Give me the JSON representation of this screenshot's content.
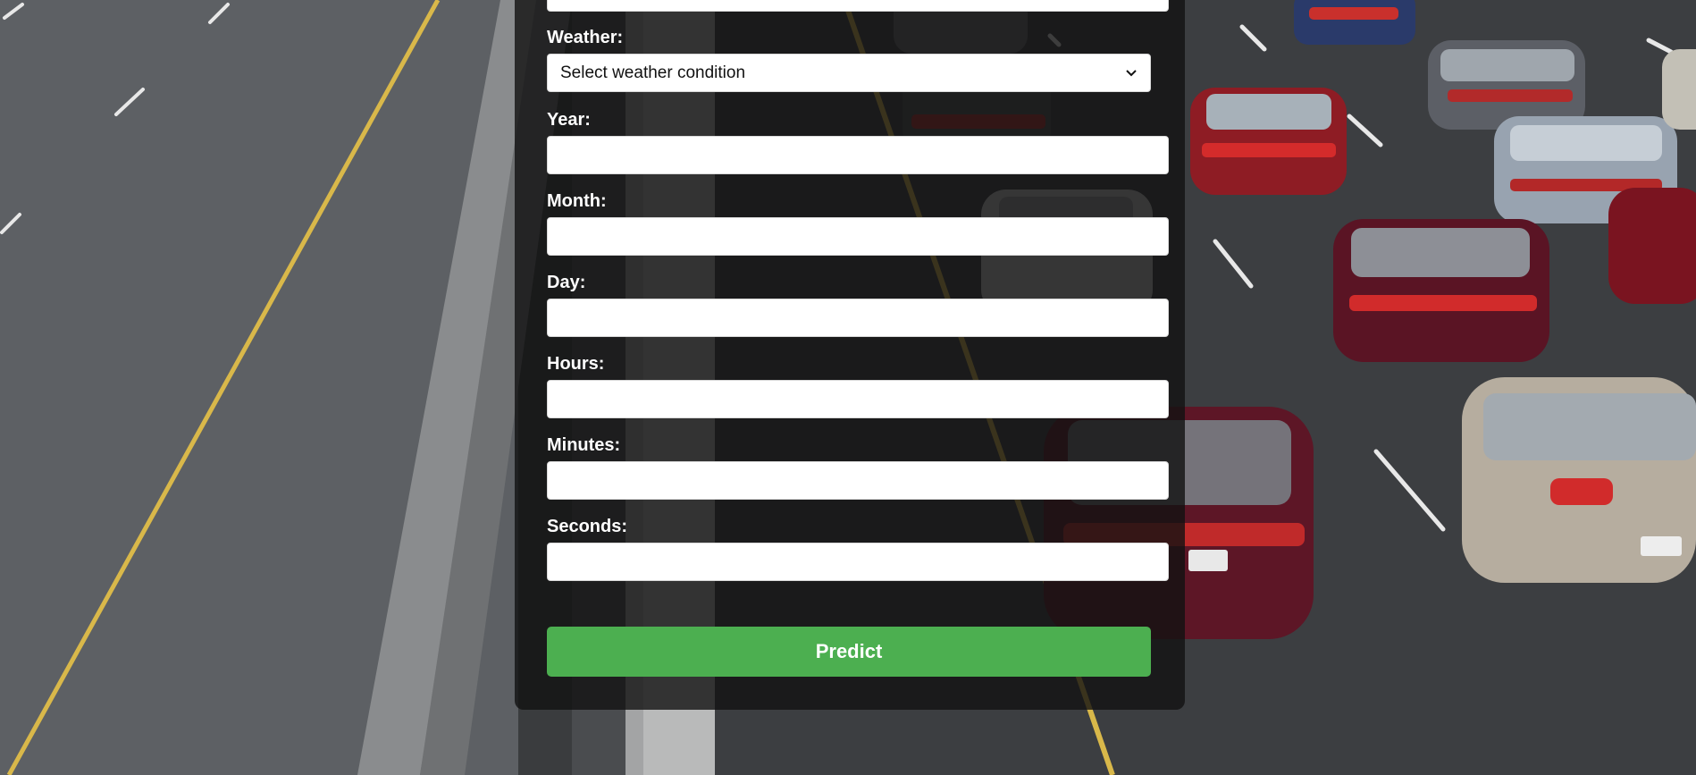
{
  "form": {
    "weather": {
      "label": "Weather:",
      "selected": "Select weather condition"
    },
    "fields": [
      {
        "label": "Year:",
        "value": ""
      },
      {
        "label": "Month:",
        "value": ""
      },
      {
        "label": "Day:",
        "value": ""
      },
      {
        "label": "Hours:",
        "value": ""
      },
      {
        "label": "Minutes:",
        "value": ""
      },
      {
        "label": "Seconds:",
        "value": ""
      }
    ],
    "submit_label": "Predict"
  },
  "colors": {
    "button_green": "#4caf50",
    "card_overlay": "#121212",
    "lane_yellow": "#d9b84a"
  },
  "icons": {
    "select_arrow": "chevron-down-icon"
  }
}
